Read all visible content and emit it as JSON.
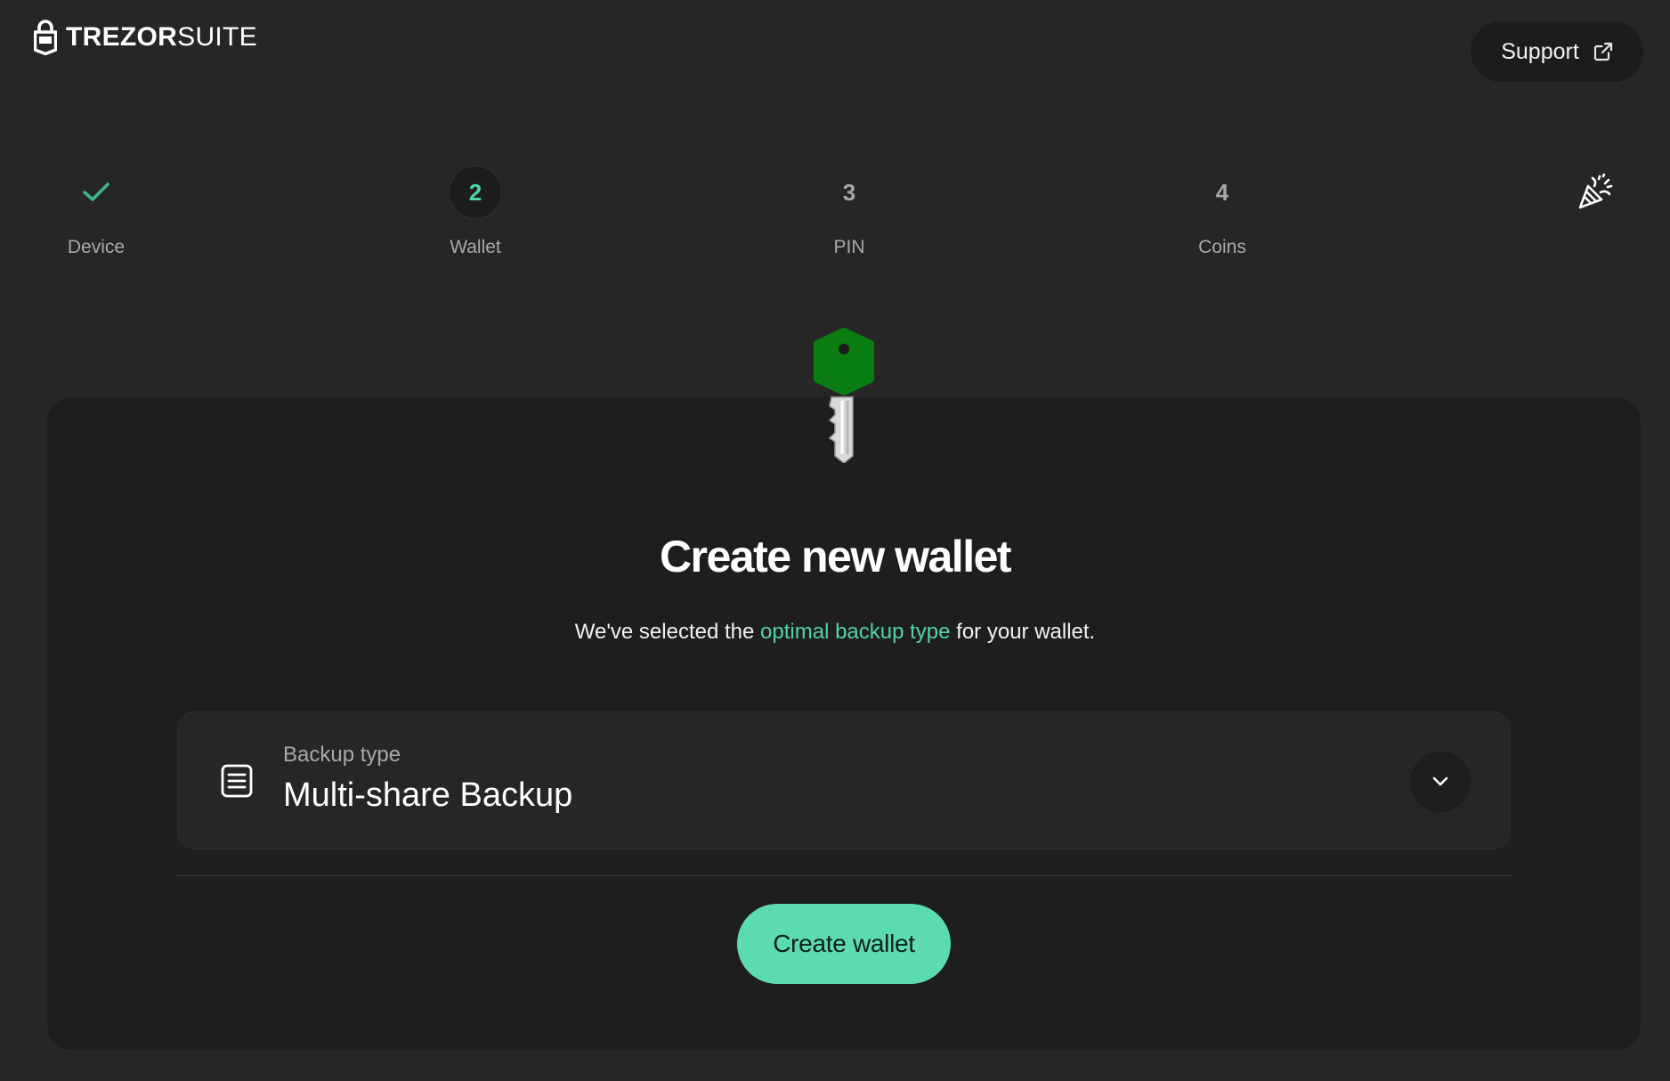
{
  "header": {
    "logo_bold": "TREZOR",
    "logo_light": "SUITE",
    "support_label": "Support",
    "support_icon": "external-link-icon"
  },
  "stepper": {
    "steps": [
      {
        "number": "",
        "label": "Device",
        "state": "done",
        "icon": "check-icon"
      },
      {
        "number": "2",
        "label": "Wallet",
        "state": "active"
      },
      {
        "number": "3",
        "label": "PIN",
        "state": "upcoming"
      },
      {
        "number": "4",
        "label": "Coins",
        "state": "upcoming"
      },
      {
        "number": "",
        "label": "",
        "state": "upcoming",
        "icon": "party-popper-icon"
      }
    ]
  },
  "main": {
    "hero_icon": "key-icon",
    "title": "Create new wallet",
    "subtitle_prefix": "We've selected the ",
    "subtitle_link": "optimal backup type",
    "subtitle_suffix": " for your wallet.",
    "backup": {
      "icon": "document-list-icon",
      "label": "Backup type",
      "value": "Multi-share Backup",
      "toggle_icon": "chevron-down-icon"
    },
    "create_button_label": "Create wallet"
  },
  "colors": {
    "background": "#262626",
    "card": "#1e1e1e",
    "accent": "#52d3a6",
    "button": "#5cdbb3",
    "key_green": "#0a7d12"
  }
}
